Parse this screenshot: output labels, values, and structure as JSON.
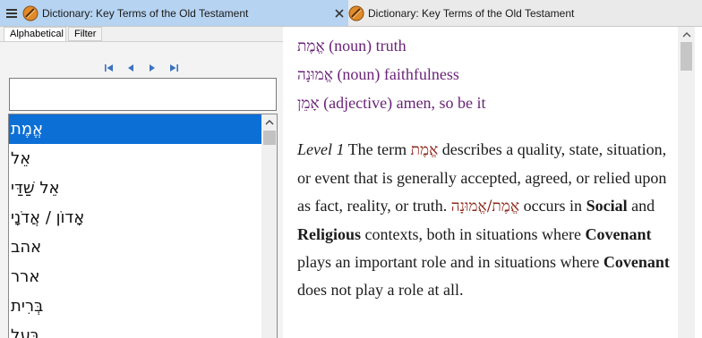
{
  "tabs": [
    {
      "title": "Dictionary: Key Terms of the Old Testament",
      "active": true
    },
    {
      "title": "Dictionary: Key Terms of the Old Testament",
      "active": false
    }
  ],
  "left": {
    "subtabs": [
      "Alphabetical",
      "Filter"
    ],
    "search": {
      "value": "",
      "placeholder": ""
    },
    "terms": [
      "אֱמֶת",
      "אֵל",
      "אֵל שַׁדַּי",
      "אָדוֹן / אֲדֹנָי",
      "אהב",
      "ארר",
      "בְּרִית",
      "בַּעַל"
    ],
    "selected_index": 0
  },
  "right": {
    "glosses": [
      {
        "hebrew": "אֱמֶת",
        "text": " (noun) truth"
      },
      {
        "hebrew": "אֱמוּנָה",
        "text": " (noun) faithfulness"
      },
      {
        "hebrew": "אָמֵן",
        "text": " (adjective) amen, so be it"
      }
    ],
    "paragraph": {
      "level": "Level 1",
      "t1": " The term ",
      "heb1": "אֱמֶת",
      "t2": " describes a quality, state, situation, or event that is generally accepted, agreed, or relied upon as fact, reality, or truth. ",
      "heb2": "אֱמֶת/אֱמוּנָה",
      "t3": " occurs in ",
      "b1": "Social",
      "t4": " and ",
      "b2": "Religious",
      "t5": " contexts, both in situations where ",
      "b3": "Covenant",
      "t6": " plays an important role and in situations where ",
      "b4": "Covenant",
      "t7": " does not play a role at all."
    }
  },
  "colors": {
    "active_tab": "#b6d3f1",
    "selection": "#0c6fd6",
    "gloss": "#6a2378",
    "hebrew_inline": "#8e2a1e"
  },
  "icons": [
    "menu-icon",
    "book-icon",
    "close-icon",
    "first-page-icon",
    "previous-icon",
    "next-icon",
    "last-page-icon",
    "scroll-up-icon"
  ]
}
